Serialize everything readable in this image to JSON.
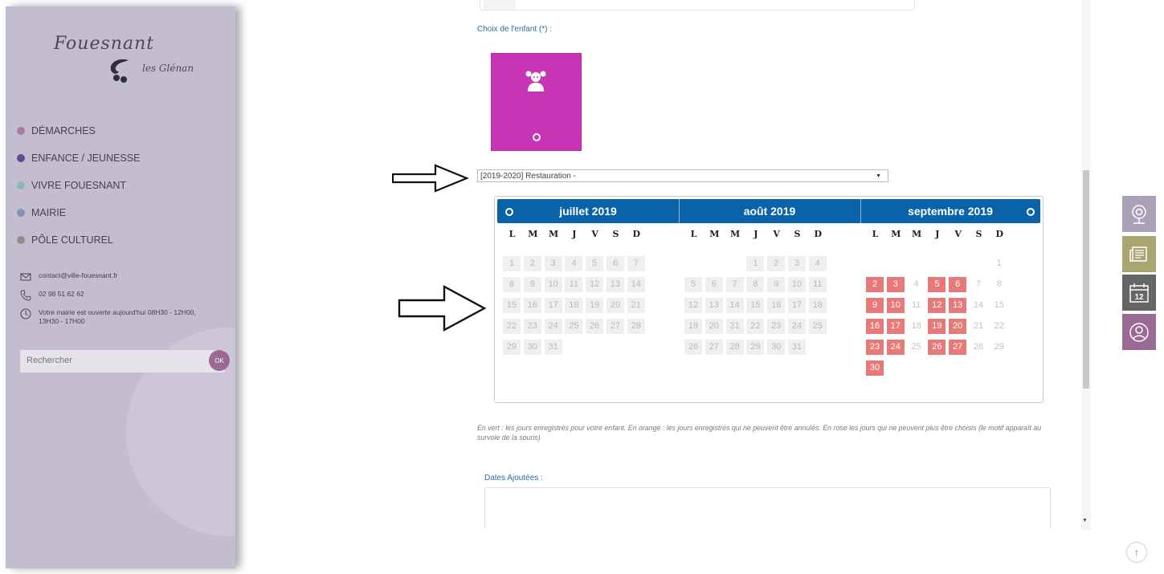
{
  "sidebar": {
    "logo": {
      "brand": "Fouesnant",
      "sub": "les Glénan"
    },
    "nav": [
      {
        "label": "DÉMARCHES",
        "color": "#a87fa2"
      },
      {
        "label": "ENFANCE / JEUNESSE",
        "color": "#5a4d92"
      },
      {
        "label": "VIVRE FOUESNANT",
        "color": "#8ab7b9"
      },
      {
        "label": "MAIRIE",
        "color": "#7f95b2"
      },
      {
        "label": "PÔLE CULTUREL",
        "color": "#8e8e8e"
      }
    ],
    "contact": {
      "email": "contact@ville-fouesnant.fr",
      "phone": "02 98 51 62 62",
      "hours": "Votre mairie est ouverte aujourd'hui 08H30 - 12H00, 13H30 - 17H00"
    },
    "search": {
      "placeholder": "Rechercher",
      "button": "OK"
    }
  },
  "main": {
    "child_label": "Choix de l'enfant (*) :",
    "select_value": "[2019-2020] Restauration -",
    "legend": "En vert : les jours enregistrés pour votre enfant. En orange : les jours enregistrés qui ne peuvent être annulés. En rose les jours qui ne peuvent plus être choisis (le motif apparaît au survole de la souris)",
    "dates_label": "Dates Ajoutées :"
  },
  "calendar": {
    "header_color": "#0a63a8",
    "unavailable_color": "#e87979",
    "weekdays": [
      "L",
      "M",
      "M",
      "J",
      "V",
      "S",
      "D"
    ],
    "months": [
      {
        "title": "juillet 2019",
        "offset": 0,
        "days": 31,
        "unavailable": []
      },
      {
        "title": "août 2019",
        "offset": 3,
        "days": 31,
        "unavailable": []
      },
      {
        "title": "septembre 2019",
        "offset": 6,
        "days": 30,
        "unavailable": [
          2,
          3,
          5,
          6,
          9,
          10,
          12,
          13,
          16,
          17,
          19,
          20,
          23,
          24,
          26,
          27,
          30
        ]
      }
    ]
  },
  "right_icons": [
    "webcam-icon",
    "newspaper-icon",
    "calendar-12-icon",
    "user-account-icon"
  ],
  "calendar_icon_text": "12"
}
